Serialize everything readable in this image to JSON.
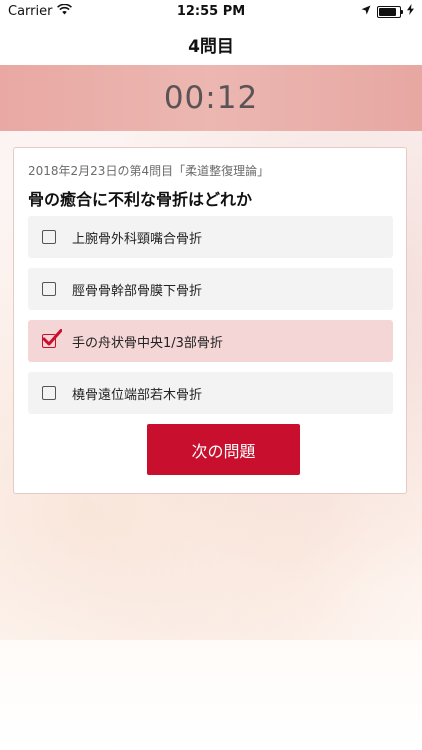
{
  "status_bar": {
    "carrier": "Carrier",
    "time": "12:55 PM"
  },
  "nav": {
    "title": "4問目"
  },
  "timer": {
    "value": "00:12"
  },
  "question": {
    "source": "2018年2月23日の第4問目「柔道整復理論」",
    "text": "骨の癒合に不利な骨折はどれか",
    "options": [
      {
        "label": "上腕骨外科頸嘴合骨折",
        "checked": false
      },
      {
        "label": "脛骨骨幹部骨膜下骨折",
        "checked": false
      },
      {
        "label": "手の舟状骨中央1/3部骨折",
        "checked": true
      },
      {
        "label": "橈骨遠位端部若木骨折",
        "checked": false
      }
    ]
  },
  "actions": {
    "next_label": "次の問題"
  },
  "colors": {
    "accent": "#c8102e",
    "selected_bg": "#f5d6d6",
    "timer_band": "#ecb7b1"
  },
  "icons": {
    "wifi": "wifi-icon",
    "location": "location-arrow-icon",
    "battery": "battery-icon",
    "charging": "charging-bolt-icon",
    "checkbox_checked": "checkmark-icon"
  }
}
